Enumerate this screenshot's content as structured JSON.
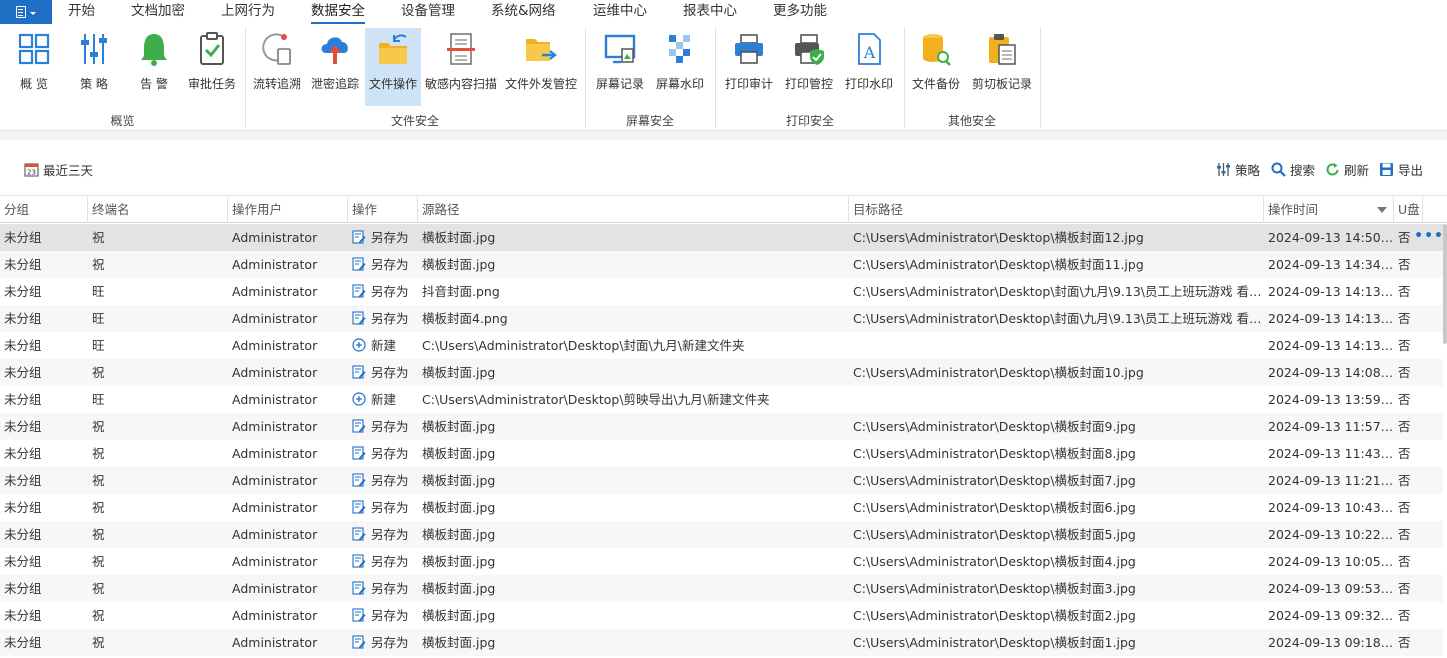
{
  "menu": {
    "tabs": [
      "开始",
      "文档加密",
      "上网行为",
      "数据安全",
      "设备管理",
      "系统&网络",
      "运维中心",
      "报表中心",
      "更多功能"
    ],
    "active_index": 3
  },
  "ribbon": {
    "buttons": [
      {
        "label": "概 览",
        "icon": "overview-grid-icon"
      },
      {
        "label": "策 略",
        "icon": "strategy-sliders-icon"
      },
      {
        "label": "告 警",
        "icon": "alarm-bell-icon"
      },
      {
        "label": "审批任务",
        "icon": "approval-clipboard-icon"
      },
      {
        "label": "流转追溯",
        "icon": "flow-trace-icon"
      },
      {
        "label": "泄密追踪",
        "icon": "leak-cloud-icon"
      },
      {
        "label": "文件操作",
        "icon": "file-operation-folder-icon"
      },
      {
        "label": "敏感内容扫描",
        "icon": "sensitive-scan-icon"
      },
      {
        "label": "文件外发管控",
        "icon": "file-outgoing-folder-icon"
      },
      {
        "label": "屏幕记录",
        "icon": "screen-record-monitor-icon"
      },
      {
        "label": "屏幕水印",
        "icon": "screen-watermark-icon"
      },
      {
        "label": "打印审计",
        "icon": "printer-audit-icon"
      },
      {
        "label": "打印管控",
        "icon": "printer-control-icon"
      },
      {
        "label": "打印水印",
        "icon": "print-watermark-icon"
      },
      {
        "label": "文件备份",
        "icon": "file-backup-icon"
      },
      {
        "label": "剪切板记录",
        "icon": "clipboard-record-icon"
      }
    ],
    "groups": [
      "概览",
      "文件安全",
      "屏幕安全",
      "打印安全",
      "其他安全"
    ],
    "active_button": "文件操作",
    "accent_color": "#1f6fc5"
  },
  "toolbar": {
    "date_filter": "最近三天",
    "strategy": "策略",
    "search": "搜索",
    "refresh": "刷新",
    "export": "导出"
  },
  "table": {
    "headers": [
      "分组",
      "终端名",
      "操作用户",
      "操作",
      "源路径",
      "目标路径",
      "操作时间",
      "U盘"
    ],
    "rows": [
      [
        "未分组",
        "祝",
        "Administrator",
        "另存为",
        "横板封面.jpg",
        "C:\\Users\\Administrator\\Desktop\\横板封面12.jpg",
        "2024-09-13 14:50:14",
        "否"
      ],
      [
        "未分组",
        "祝",
        "Administrator",
        "另存为",
        "横板封面.jpg",
        "C:\\Users\\Administrator\\Desktop\\横板封面11.jpg",
        "2024-09-13 14:34:57",
        "否"
      ],
      [
        "未分组",
        "旺",
        "Administrator",
        "另存为",
        "抖音封面.png",
        "C:\\Users\\Administrator\\Desktop\\封面\\九月\\9.13\\员工上班玩游戏 看电...",
        "2024-09-13 14:13:50",
        "否"
      ],
      [
        "未分组",
        "旺",
        "Administrator",
        "另存为",
        "横板封面4.png",
        "C:\\Users\\Administrator\\Desktop\\封面\\九月\\9.13\\员工上班玩游戏 看电...",
        "2024-09-13 14:13:39",
        "否"
      ],
      [
        "未分组",
        "旺",
        "Administrator",
        "新建",
        "C:\\Users\\Administrator\\Desktop\\封面\\九月\\新建文件夹",
        "",
        "2024-09-13 14:13:32",
        "否"
      ],
      [
        "未分组",
        "祝",
        "Administrator",
        "另存为",
        "横板封面.jpg",
        "C:\\Users\\Administrator\\Desktop\\横板封面10.jpg",
        "2024-09-13 14:08:34",
        "否"
      ],
      [
        "未分组",
        "旺",
        "Administrator",
        "新建",
        "C:\\Users\\Administrator\\Desktop\\剪映导出\\九月\\新建文件夹",
        "",
        "2024-09-13 13:59:48",
        "否"
      ],
      [
        "未分组",
        "祝",
        "Administrator",
        "另存为",
        "横板封面.jpg",
        "C:\\Users\\Administrator\\Desktop\\横板封面9.jpg",
        "2024-09-13 11:57:35",
        "否"
      ],
      [
        "未分组",
        "祝",
        "Administrator",
        "另存为",
        "横板封面.jpg",
        "C:\\Users\\Administrator\\Desktop\\横板封面8.jpg",
        "2024-09-13 11:43:16",
        "否"
      ],
      [
        "未分组",
        "祝",
        "Administrator",
        "另存为",
        "横板封面.jpg",
        "C:\\Users\\Administrator\\Desktop\\横板封面7.jpg",
        "2024-09-13 11:21:38",
        "否"
      ],
      [
        "未分组",
        "祝",
        "Administrator",
        "另存为",
        "横板封面.jpg",
        "C:\\Users\\Administrator\\Desktop\\横板封面6.jpg",
        "2024-09-13 10:43:59",
        "否"
      ],
      [
        "未分组",
        "祝",
        "Administrator",
        "另存为",
        "横板封面.jpg",
        "C:\\Users\\Administrator\\Desktop\\横板封面5.jpg",
        "2024-09-13 10:22:14",
        "否"
      ],
      [
        "未分组",
        "祝",
        "Administrator",
        "另存为",
        "横板封面.jpg",
        "C:\\Users\\Administrator\\Desktop\\横板封面4.jpg",
        "2024-09-13 10:05:58",
        "否"
      ],
      [
        "未分组",
        "祝",
        "Administrator",
        "另存为",
        "横板封面.jpg",
        "C:\\Users\\Administrator\\Desktop\\横板封面3.jpg",
        "2024-09-13 09:53:12",
        "否"
      ],
      [
        "未分组",
        "祝",
        "Administrator",
        "另存为",
        "横板封面.jpg",
        "C:\\Users\\Administrator\\Desktop\\横板封面2.jpg",
        "2024-09-13 09:32:15",
        "否"
      ],
      [
        "未分组",
        "祝",
        "Administrator",
        "另存为",
        "横板封面.jpg",
        "C:\\Users\\Administrator\\Desktop\\横板封面1.jpg",
        "2024-09-13 09:18:41",
        "否"
      ]
    ],
    "selected_row": 0,
    "sorted_column": "操作时间",
    "row_more_icon": "more-dots-icon"
  }
}
